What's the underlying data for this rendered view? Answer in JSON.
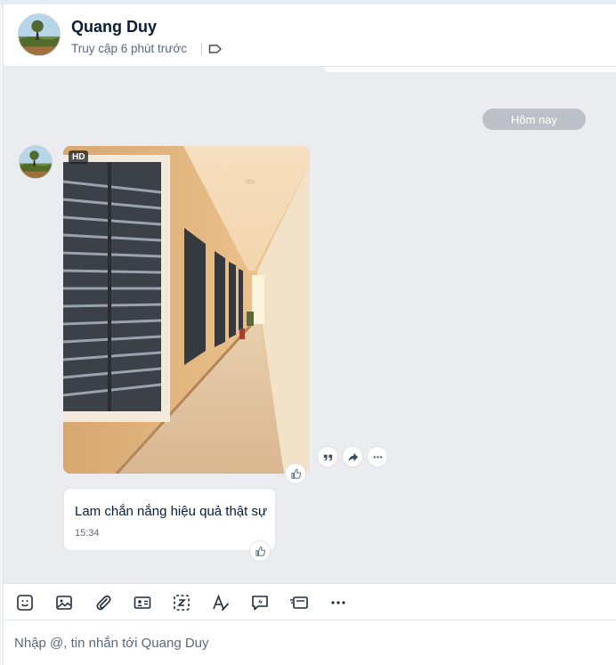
{
  "header": {
    "contact_name": "Quang Duy",
    "status": "Truy cập 6 phút trước"
  },
  "chat": {
    "date_divider": "Hôm nay",
    "photo_badge": "HD",
    "message": {
      "text": "Lam chắn nắng hiệu quả thật sự",
      "time": "15:34"
    }
  },
  "composer": {
    "placeholder": "Nhập @, tin nhắn tới Quang Duy"
  },
  "icons": {
    "header": [
      "avatar",
      "tag-icon"
    ],
    "photo_actions": [
      "quote-icon",
      "forward-icon",
      "more-icon"
    ],
    "toolbar": [
      "sticker-icon",
      "image-icon",
      "attachment-icon",
      "contact-card-icon",
      "screenshot-icon",
      "text-format-icon",
      "quick-message-icon",
      "card-icon",
      "more-icon"
    ]
  },
  "colors": {
    "chat_background": "#ebecf0",
    "date_pill": "#bcc1c9",
    "text_primary": "#081b3a",
    "text_secondary": "#5a6981"
  }
}
